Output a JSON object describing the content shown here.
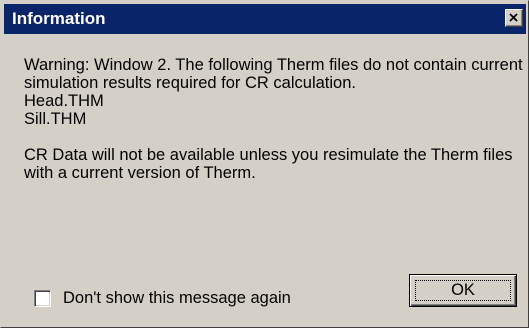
{
  "window": {
    "title": "Information",
    "close_icon": "close-icon"
  },
  "message": {
    "lines": [
      "Warning: Window 2. The following Therm files do not contain current",
      "simulation results required for CR calculation.",
      "Head.THM",
      "Sill.THM",
      "",
      "CR Data will not be available unless you resimulate the Therm files",
      "with a current version of Therm."
    ]
  },
  "checkbox": {
    "label": "Don't show this message again",
    "checked": false
  },
  "buttons": {
    "ok_label": "OK"
  },
  "colors": {
    "titlebar": "#0a246a",
    "dialog_bg": "#d4d0c8"
  }
}
